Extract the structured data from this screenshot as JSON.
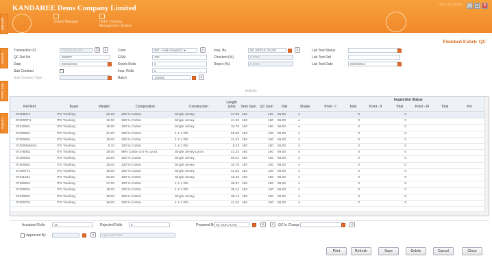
{
  "window": {
    "title": "KANDAREE Dems Company Limited",
    "user_text": "Log in for admin",
    "minimize": "_",
    "maximize": "▢",
    "close": "✕"
  },
  "menu": [
    {
      "label": "Sistem Manager"
    },
    {
      "label": "Order Tracking Management System"
    }
  ],
  "side_tabs": [
    "Main Info",
    "Roll Info",
    "PPBC SQF",
    "Reports"
  ],
  "form_title": "Finished Fabric QC",
  "fields": {
    "transaction_id_label": "Transaction ID",
    "transaction_id": "FFQCH-01-101",
    "qc_ref_label": "QC Ref No",
    "qc_ref": "000607",
    "date_label": "Date",
    "date": "06/03/2016",
    "sub_contract_label": "Sub Contract",
    "sub_contract": "",
    "sub_contract_type_label": "Sub Contract Type",
    "sub_contract_type": "",
    "color_label": "Color",
    "color": "007 - Antik Grey(SC) ►",
    "gsm_label": "GSM",
    "gsm": "160",
    "knock_rolls_label": "Knock Rolls",
    "knock_rolls": "6",
    "insp_rolls_label": "Insp. Rolls",
    "insp_rolls": "6",
    "batch_label": "Batch",
    "batch": "133656",
    "insp_by_label": "Insp. By",
    "insp_by": "Mr. ARIFUL ISLAM",
    "checked_label": "Checked (%)",
    "checked": "0.0000",
    "reject_label": "Reject (%)",
    "reject": "0.0000",
    "lab_test_status_label": "Lab Test Status",
    "lab_test_status": "",
    "lab_test_ref_label": "Lab Test Ref",
    "lab_test_ref": "",
    "lab_test_date_label": "Lab Test Date",
    "lab_test_date": "06/03/2016"
  },
  "roll_info_label": "Roll Info",
  "grid": {
    "inspection_status": "Inspection Status",
    "columns": [
      "Roll Ref",
      "Buyer",
      "Weight",
      "Composition",
      "Construction",
      "Length (yds)",
      "Item Gsm",
      "QC Gsm",
      "DIA",
      "Shade",
      "Point - I",
      "Total",
      "Point - II",
      "Total",
      "Point - III",
      "Total",
      "Poi"
    ],
    "rows": [
      [
        "07300571",
        "ITX Tracking",
        "22.00",
        "100 % Cotton",
        "Single Jersey",
        "47.08",
        "160",
        "160",
        "65.00",
        "A",
        "0",
        "0"
      ],
      [
        "073000TH",
        "ITX Tracking",
        "19.00",
        "100 % Cotton",
        "Single Jersey",
        "41.32",
        "160",
        "160",
        "65.00",
        "A",
        "0",
        "0"
      ],
      [
        "07310661",
        "ITX Tracking",
        "16.00",
        "100 % Cotton",
        "Single Jersey",
        "34.75",
        "160",
        "160",
        "65.00",
        "A",
        "0",
        "0"
      ],
      [
        "07300651",
        "ITX Tracking",
        "21.00",
        "100 % Cotton",
        "1 X 1 Rib",
        "55.85",
        "160",
        "160",
        "65.00",
        "A",
        "0",
        "0"
      ],
      [
        "07300691",
        "ITX Tracking",
        "19.00",
        "100 % Cotton",
        "1 X 1 Rib",
        "41.32",
        "160",
        "160",
        "65.00",
        "A",
        "0",
        "0"
      ],
      [
        "07300659(K4)",
        "ITX Tracking",
        "5.10",
        "100 % Cotton",
        "1 X 1 Rib",
        "8.23",
        "160",
        "160",
        "65.00",
        "A",
        "0",
        "0"
      ],
      [
        "07378081",
        "ITX Tracking",
        "19.00",
        "98% Cotton & 5 % Lycra",
        "Single Jersey Lycra",
        "41.32",
        "160",
        "160",
        "65.00",
        "A",
        "0",
        "0"
      ],
      [
        "07300661",
        "ITX Tracking",
        "23.00",
        "100 % Cotton",
        "Single Jersey",
        "50.01",
        "160",
        "160",
        "65.00",
        "A",
        "0",
        "0"
      ],
      [
        "07300581",
        "ITX Tracking",
        "16.00",
        "100 % Cotton",
        "Single Jersey",
        "34.79",
        "160",
        "160",
        "65.00",
        "A",
        "0",
        "0"
      ],
      [
        "073007T1",
        "ITX Tracking",
        "19.00",
        "100 % Cotton",
        "Single Jersey",
        "41.32",
        "160",
        "160",
        "65.00",
        "A",
        "0",
        "0"
      ],
      [
        "07311251",
        "ITX Tracking",
        "20.00",
        "100 % Cotton",
        "Single Jersey",
        "43.49",
        "160",
        "160",
        "65.00",
        "A",
        "0",
        "0"
      ],
      [
        "07300601",
        "ITX Tracking",
        "17.00",
        "100 % Cotton",
        "1 X 1 Rib",
        "36.97",
        "160",
        "160",
        "65.00",
        "A",
        "0",
        "0"
      ],
      [
        "07300601",
        "ITX Tracking",
        "18.00",
        "100 % Cotton",
        "1 X 1 Rib",
        "39.14",
        "160",
        "160",
        "65.00",
        "A",
        "0",
        "0"
      ],
      [
        "07310691",
        "ITX Tracking",
        "18.00",
        "100 % Cotton",
        "Single Jersey",
        "39.14",
        "160",
        "160",
        "65.00",
        "A",
        "0",
        "0"
      ],
      [
        "07300701",
        "ITX Tracking",
        "19.00",
        "100 % Cotton",
        "1 X 1 Rib",
        "41.32",
        "160",
        "160",
        "65.00",
        "A",
        "0",
        "0"
      ]
    ]
  },
  "footer": {
    "accepted_rolls_label": "Accepted Rolls",
    "accepted_rolls": "15",
    "rejected_rolls_label": "Rejected Rolls",
    "rejected_rolls": "0",
    "prepared_by_label": "Prepared By",
    "prepared_by": "Mr. NUR ALAM",
    "qc_in_charge_label": "QC In Charge",
    "qc_in_charge": "",
    "approved_by_label": "Approved By",
    "approved_by": "",
    "approved_date": "Approved Date"
  },
  "buttons": {
    "print": "Print",
    "refresh": "Refresh",
    "save": "Save",
    "delete": "Delete",
    "cancel": "Cancel",
    "close": "Close"
  }
}
